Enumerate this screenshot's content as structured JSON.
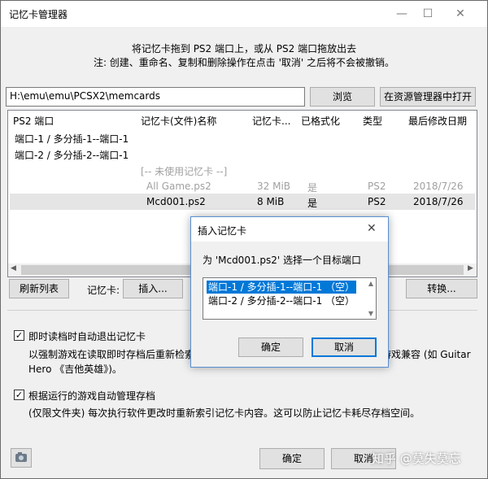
{
  "window": {
    "title": "记忆卡管理器",
    "instruction1": "将记忆卡拖到 PS2 端口上，或从 PS2 端口拖放出去",
    "instruction2": "注: 创建、重命名、复制和删除操作在点击 '取消' 之后将不会被撤销。"
  },
  "path": {
    "value": "H:\\emu\\emu\\PCSX2\\memcards",
    "browse_label": "浏览",
    "explorer_label": "在资源管理器中打开"
  },
  "list": {
    "columns": [
      "PS2 端口",
      "记忆卡(文件)名称",
      "记忆卡...",
      "已格式化",
      "类型",
      "最后修改日期"
    ],
    "ports": [
      "端口-1 / 多分插-1--端口-1",
      "端口-2 / 多分插-2--端口-1"
    ],
    "unused_label": "[-- 未使用记忆卡 --]",
    "rows": [
      {
        "name": "All Game.ps2",
        "size": "32 MiB",
        "formatted": "是",
        "type": "PS2",
        "date": "2018/7/26",
        "dim": true
      },
      {
        "name": "Mcd001.ps2",
        "size": "8 MiB",
        "formatted": "是",
        "type": "PS2",
        "date": "2018/7/26",
        "dim": false
      }
    ]
  },
  "toolbar": {
    "refresh_label": "刷新列表",
    "card_label": "记忆卡:",
    "insert_label": "插入...",
    "convert_label": "转换..."
  },
  "options": {
    "opt1_label": "即时读档时自动退出记忆卡",
    "opt1_desc_left": "以强制游戏在读取即时存档后重新检索记",
    "opt1_desc_right": "游戏兼容 (如 Guitar",
    "opt1_desc_line2": "Hero 《吉他英雄》)。",
    "opt2_label": "根据运行的游戏自动管理存档",
    "opt2_desc": "(仅限文件夹) 每次执行软件更改时重新索引记忆卡内容。这可以防止记忆卡耗尽存档空间。"
  },
  "footer": {
    "ok_label": "确定",
    "cancel_label": "取消"
  },
  "dialog": {
    "title": "插入记忆卡",
    "prompt": "为 'Mcd001.ps2' 选择一个目标端口",
    "options": [
      "端口-1 / 多分插-1--端口-1 （空）",
      "端口-2 / 多分插-2--端口-1 （空）"
    ],
    "ok_label": "确定",
    "cancel_label": "取消"
  },
  "watermark": "知乎 @莫失莫忘",
  "colors": {
    "selection": "#0078d7",
    "accent_border": "#0078d7"
  },
  "icons": [
    "minimize-icon",
    "maximize-icon",
    "close-icon",
    "config-icon",
    "scroll-left-icon",
    "scroll-right-icon",
    "scroll-up-icon",
    "scroll-down-icon"
  ]
}
